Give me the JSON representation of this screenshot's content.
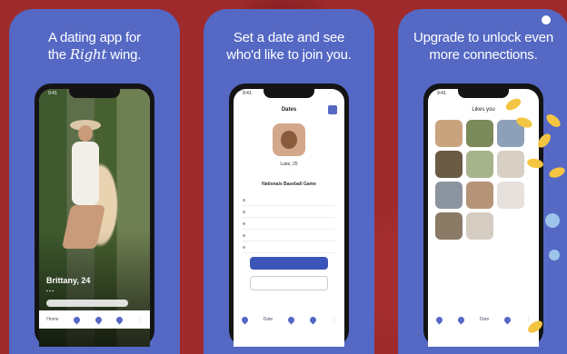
{
  "panels": [
    {
      "headline_line1": "A dating app for",
      "headline_line2_pre": "the ",
      "headline_line2_script": "Right",
      "headline_line2_post": " wing."
    },
    {
      "headline_line1": "Set a date and see",
      "headline_line2": "who'd like to join you."
    },
    {
      "headline_line1": "Upgrade to unlock even",
      "headline_line2": "more connections."
    }
  ],
  "phone1": {
    "time": "9:41",
    "profile_name": "Brittany, 24",
    "tabbar": [
      "Home",
      "",
      "",
      "",
      ""
    ]
  },
  "phone2": {
    "time": "9:41",
    "title": "Dates",
    "person_name": "Luke, 25",
    "venue": "Nationals Baseball Game",
    "tabbar": [
      "",
      "Date",
      "",
      "",
      ""
    ]
  },
  "phone3": {
    "time": "9:41",
    "title": "Likes you",
    "tabbar": [
      "",
      "",
      "Date",
      "",
      ""
    ]
  },
  "colors": {
    "background": "#9e2a2b",
    "card": "#5468c4",
    "primary_button": "#3b56b8",
    "accent_yellow": "#f4c542"
  }
}
